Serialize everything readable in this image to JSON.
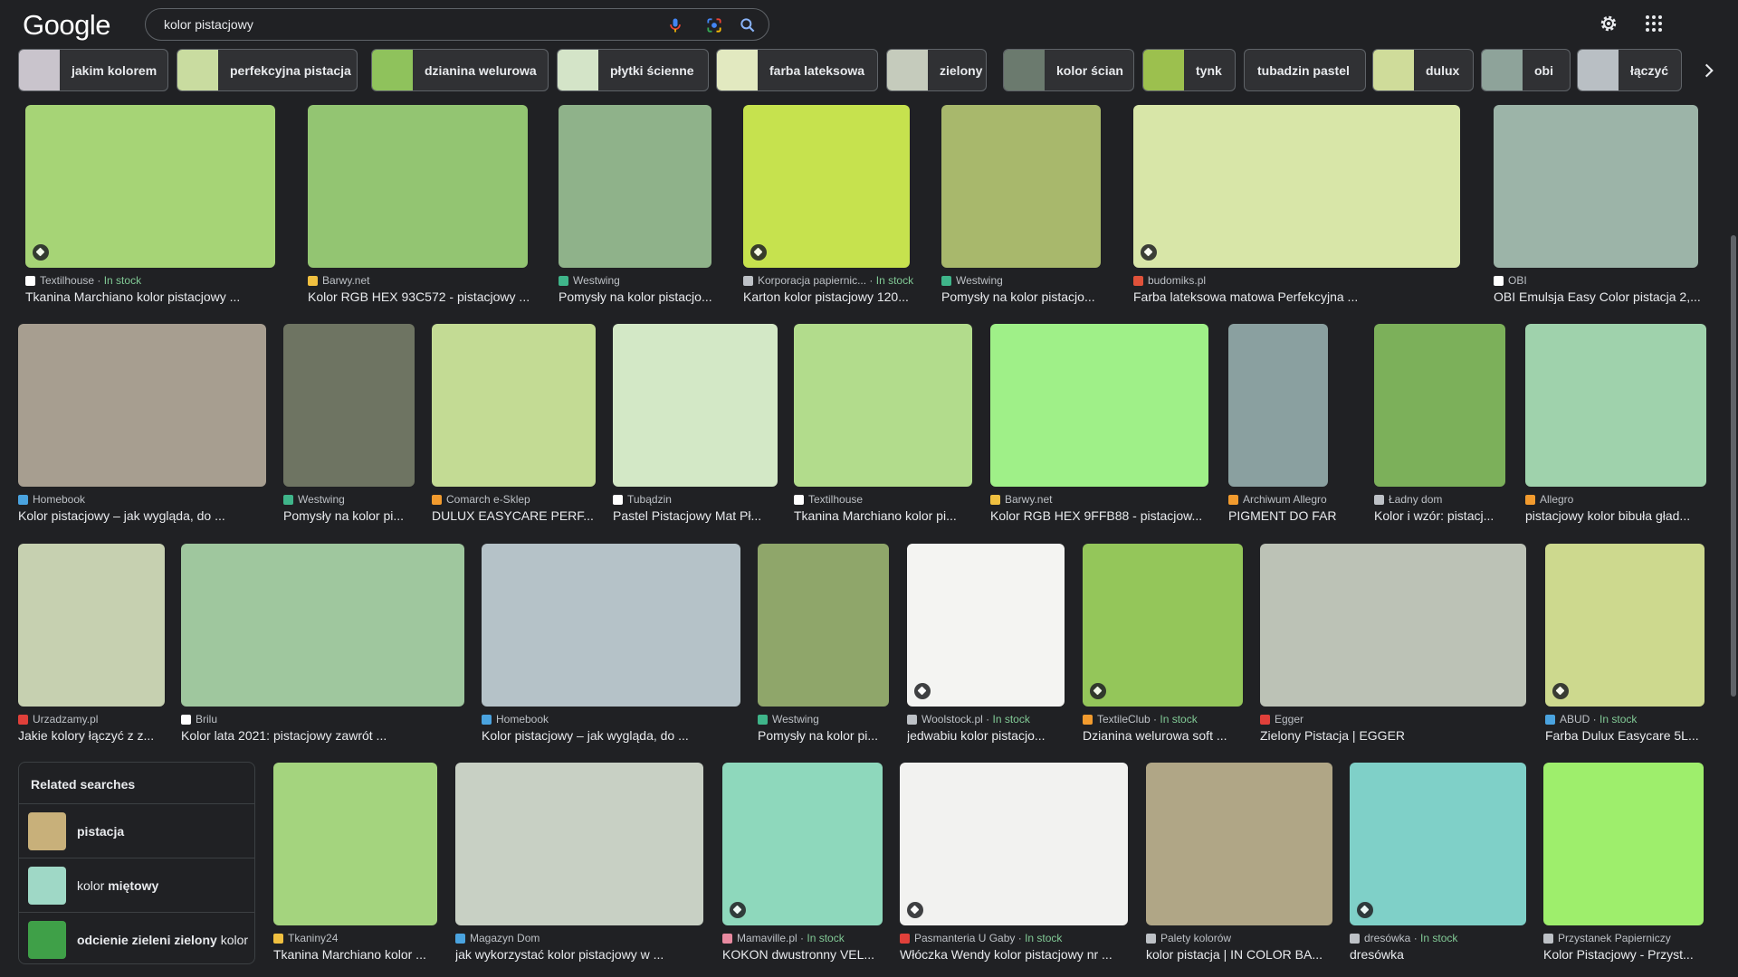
{
  "header": {
    "logo": "Google",
    "query": "kolor pistacjowy"
  },
  "chips": [
    {
      "label": "jakim kolorem",
      "color": "#c9c4cc"
    },
    {
      "label": "perfekcyjna pistacja",
      "color": "#c9dca0"
    },
    {
      "label": "dzianina welurowa",
      "color": "#8fc25c"
    },
    {
      "label": "płytki ścienne",
      "color": "#d4e4c8"
    },
    {
      "label": "farba lateksowa",
      "color": "#e2e9c0"
    },
    {
      "label": "zielony",
      "color": "#c5cbbc"
    },
    {
      "label": "kolor ścian",
      "color": "#6b7a6e"
    },
    {
      "label": "tynk",
      "color": "#9cc04e"
    },
    {
      "label": "tubadzin pastel",
      "color": ""
    },
    {
      "label": "dulux",
      "color": "#cfdc9a"
    },
    {
      "label": "obi",
      "color": "#8ea39a"
    },
    {
      "label": "łączyć",
      "color": "#b9bfc4"
    }
  ],
  "rows": [
    [
      {
        "source": "Textilhouse",
        "stock": "In stock",
        "title": "Tkanina Marchiano kolor pistacjowy ...",
        "color": "#a6d476",
        "fav": "#ffffff",
        "tag": true
      },
      {
        "source": "Barwy.net",
        "stock": "",
        "title": "Kolor RGB HEX 93C572 - pistacjowy ...",
        "color": "#93c572",
        "fav": "#f0c040",
        "tag": false
      },
      {
        "source": "Westwing",
        "stock": "",
        "title": "Pomysły na kolor pistacjo...",
        "color": "#8fb28a",
        "fav": "#3fb58a",
        "tag": false
      },
      {
        "source": "Korporacja papiernic...",
        "stock": "In stock",
        "title": "Karton kolor pistacjowy 120...",
        "color": "#c6e24e",
        "fav": "#bdc1c6",
        "tag": true
      },
      {
        "source": "Westwing",
        "stock": "",
        "title": "Pomysły na kolor pistacjo...",
        "color": "#a8b86c",
        "fav": "#3fb58a",
        "tag": false
      },
      {
        "source": "budomiks.pl",
        "stock": "",
        "title": "Farba lateksowa matowa Perfekcyjna ...",
        "color": "#d8e6a8",
        "fav": "#e0523a",
        "tag": true
      },
      {
        "source": "OBI",
        "stock": "",
        "title": "OBI Emulsja Easy Color pistacja 2,...",
        "color": "#9cb4a8",
        "fav": "#ffffff",
        "tag": false
      }
    ],
    [
      {
        "source": "Homebook",
        "stock": "",
        "title": "Kolor pistacjowy – jak wygląda, do ...",
        "color": "#a79e90",
        "fav": "#4aa3df",
        "tag": false
      },
      {
        "source": "Westwing",
        "stock": "",
        "title": "Pomysły na kolor pi...",
        "color": "#6e7462",
        "fav": "#3fb58a",
        "tag": false
      },
      {
        "source": "Comarch e-Sklep",
        "stock": "",
        "title": "DULUX EASYCARE PERF...",
        "color": "#c3db94",
        "fav": "#f29b2e",
        "tag": false
      },
      {
        "source": "Tubądzin",
        "stock": "",
        "title": "Pastel Pistacjowy Mat Pł...",
        "color": "#d3e8c6",
        "fav": "#ffffff",
        "tag": false
      },
      {
        "source": "Textilhouse",
        "stock": "",
        "title": "Tkanina Marchiano kolor pi...",
        "color": "#b2dc8c",
        "fav": "#ffffff",
        "tag": false
      },
      {
        "source": "Barwy.net",
        "stock": "",
        "title": "Kolor RGB HEX 9FFB88 - pistacjow...",
        "color": "#9ff088",
        "fav": "#f0c040",
        "tag": false
      },
      {
        "source": "Archiwum Allegro",
        "stock": "",
        "title": "PIGMENT DO FARB ...",
        "color": "#8aa0a0",
        "fav": "#f29b2e",
        "tag": false
      },
      {
        "source": "Ładny dom",
        "stock": "",
        "title": "Kolor i wzór: pistacj...",
        "color": "#7cb05a",
        "fav": "#bdc1c6",
        "tag": false
      },
      {
        "source": "Allegro",
        "stock": "",
        "title": "pistacjowy kolor bibuła gład...",
        "color": "#9fd2ac",
        "fav": "#f29b2e",
        "tag": false
      }
    ],
    [
      {
        "source": "Urzadzamy.pl",
        "stock": "",
        "title": "Jakie kolory łączyć z z...",
        "color": "#c6d0b0",
        "fav": "#e0403a",
        "tag": false
      },
      {
        "source": "Brilu",
        "stock": "",
        "title": "Kolor lata 2021: pistacjowy zawrót ...",
        "color": "#9fc79e",
        "fav": "#ffffff",
        "tag": false
      },
      {
        "source": "Homebook",
        "stock": "",
        "title": "Kolor pistacjowy – jak wygląda, do ...",
        "color": "#b5c2c8",
        "fav": "#4aa3df",
        "tag": false
      },
      {
        "source": "Westwing",
        "stock": "",
        "title": "Pomysły na kolor pi...",
        "color": "#8fa66a",
        "fav": "#3fb58a",
        "tag": false
      },
      {
        "source": "Woolstock.pl",
        "stock": "In stock",
        "title": "jedwabiu kolor pistacjo...",
        "color": "#f4f4f2",
        "fav": "#bdc1c6",
        "tag": true
      },
      {
        "source": "TextileClub",
        "stock": "In stock",
        "title": "Dzianina welurowa soft ...",
        "color": "#94c65a",
        "fav": "#f29b2e",
        "tag": true
      },
      {
        "source": "Egger",
        "stock": "",
        "title": "Zielony Pistacja | EGGER",
        "color": "#bcc2b6",
        "fav": "#e0403a",
        "tag": false
      },
      {
        "source": "ABUD",
        "stock": "In stock",
        "title": "Farba Dulux Easycare 5L...",
        "color": "#cdd98e",
        "fav": "#4aa3df",
        "tag": true
      }
    ],
    [
      {
        "source": "Tkaniny24",
        "stock": "",
        "title": "Tkanina Marchiano kolor ...",
        "color": "#a4d47e",
        "fav": "#f0c040",
        "tag": false
      },
      {
        "source": "Magazyn Dom",
        "stock": "",
        "title": "jak wykorzystać kolor pistacjowy w ...",
        "color": "#c8d0c4",
        "fav": "#4aa3df",
        "tag": false
      },
      {
        "source": "Mamaville.pl",
        "stock": "In stock",
        "title": "KOKON dwustronny VEL...",
        "color": "#8ed8bc",
        "fav": "#e88aa0",
        "tag": true
      },
      {
        "source": "Pasmanteria U Gaby",
        "stock": "In stock",
        "title": "Włóczka Wendy kolor pistacjowy nr ...",
        "color": "#f2f2f0",
        "fav": "#e0403a",
        "tag": true
      },
      {
        "source": "Palety kolorów",
        "stock": "",
        "title": "kolor pistacja | IN COLOR BA...",
        "color": "#b0a686",
        "fav": "#bdc1c6",
        "tag": false
      },
      {
        "source": "dresówka",
        "stock": "In stock",
        "title": "dresówka",
        "color": "#7fd0c8",
        "fav": "#bdc1c6",
        "tag": true
      },
      {
        "source": "Przystanek Papierniczy",
        "stock": "",
        "title": "Kolor Pistacjowy - Przyst...",
        "color": "#9eee6c",
        "fav": "#bdc1c6",
        "tag": false
      }
    ]
  ],
  "related": {
    "title": "Related searches",
    "items": [
      {
        "pre": "",
        "bold": "pistacja",
        "post": "",
        "color": "#c8b07a"
      },
      {
        "pre": "kolor ",
        "bold": "miętowy",
        "post": "",
        "color": "#9fd8c6"
      },
      {
        "pre": "",
        "bold": "odcienie zieleni zielony",
        "post": " kolor",
        "color": "#3fa048"
      }
    ]
  }
}
